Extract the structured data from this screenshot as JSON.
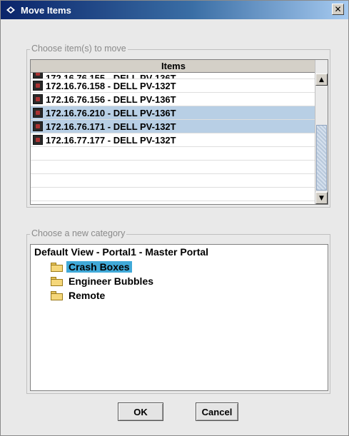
{
  "window": {
    "title": "Move Items",
    "close_glyph": "✕"
  },
  "items_group": {
    "label": "Choose item(s) to move",
    "column_header": "Items",
    "rows": [
      {
        "text": "172.16.76.155 - DELL PV-136T",
        "selected": false,
        "partial": true
      },
      {
        "text": "172.16.76.158 - DELL PV-132T",
        "selected": false
      },
      {
        "text": "172.16.76.156 - DELL PV-136T",
        "selected": false
      },
      {
        "text": "172.16.76.210 - DELL PV-136T",
        "selected": true
      },
      {
        "text": "172.16.76.171 - DELL PV-132T",
        "selected": true
      },
      {
        "text": "172.16.77.177 - DELL PV-132T",
        "selected": false
      },
      {
        "text": "",
        "selected": false
      },
      {
        "text": "",
        "selected": false
      },
      {
        "text": "",
        "selected": false
      },
      {
        "text": "",
        "selected": false
      }
    ]
  },
  "category_group": {
    "label": "Choose a new category",
    "root": "Default View - Portal1 - Master Portal",
    "children": [
      {
        "label": "Crash Boxes",
        "selected": true
      },
      {
        "label": "Engineer Bubbles",
        "selected": false
      },
      {
        "label": "Remote",
        "selected": false
      }
    ]
  },
  "buttons": {
    "ok": "OK",
    "cancel": "Cancel"
  },
  "colors": {
    "selection": "#b8cfe5",
    "tree_selection": "#40a9d8",
    "titlebar_start": "#0a246a"
  }
}
